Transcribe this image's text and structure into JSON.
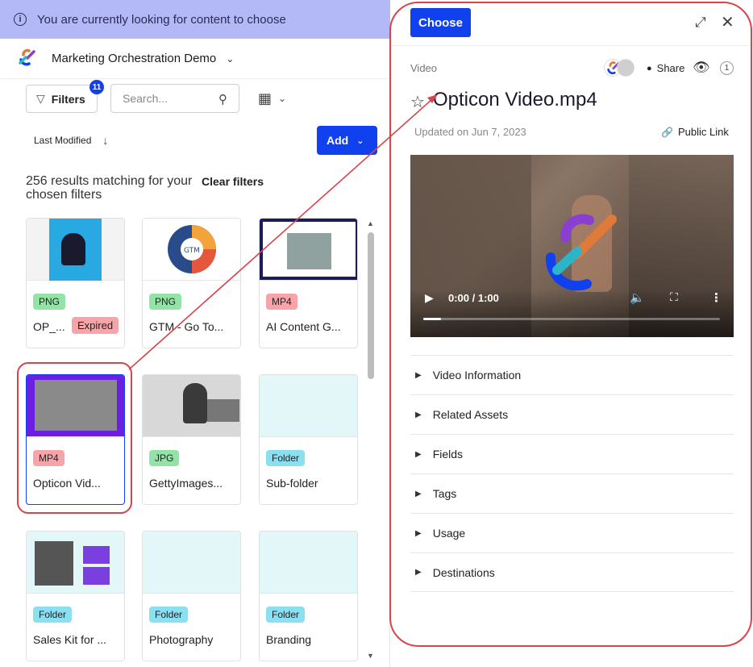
{
  "banner": {
    "text": "You are currently looking for content to choose",
    "icon": "info-icon"
  },
  "project": {
    "name": "Marketing Orchestration Demo"
  },
  "toolbar": {
    "filters_label": "Filters",
    "filters_count": "11",
    "search_placeholder": "Search...",
    "sort_label": "Last Modified",
    "add_label": "Add"
  },
  "results": {
    "summary": "256 results matching for your chosen filters",
    "clear_label": "Clear filters"
  },
  "cards": [
    {
      "type": "PNG",
      "title": "OP_...",
      "extra_badge": "Expired"
    },
    {
      "type": "PNG",
      "title": "GTM - Go To..."
    },
    {
      "type": "MP4",
      "title": "AI Content G..."
    },
    {
      "type": "MP4",
      "title": "Opticon Vid...",
      "selected": true
    },
    {
      "type": "JPG",
      "title": "GettyImages..."
    },
    {
      "type": "Folder",
      "title": "Sub-folder"
    },
    {
      "type": "Folder",
      "title": "Sales Kit for ..."
    },
    {
      "type": "Folder",
      "title": "Photography"
    },
    {
      "type": "Folder",
      "title": "Branding"
    }
  ],
  "detail": {
    "choose_label": "Choose",
    "asset_type": "Video",
    "share_label": "Share",
    "view_count": "1",
    "title": "Opticon Video.mp4",
    "updated": "Updated on Jun 7, 2023",
    "public_link": "Public Link",
    "video": {
      "time": "0:00 / 1:00",
      "progress": 0.06
    },
    "sections": [
      "Video Information",
      "Related Assets",
      "Fields",
      "Tags",
      "Usage",
      "Destinations"
    ]
  },
  "colors": {
    "accent": "#1140ee",
    "banner_bg": "#b3b9f7",
    "annotation": "#d9434b"
  }
}
